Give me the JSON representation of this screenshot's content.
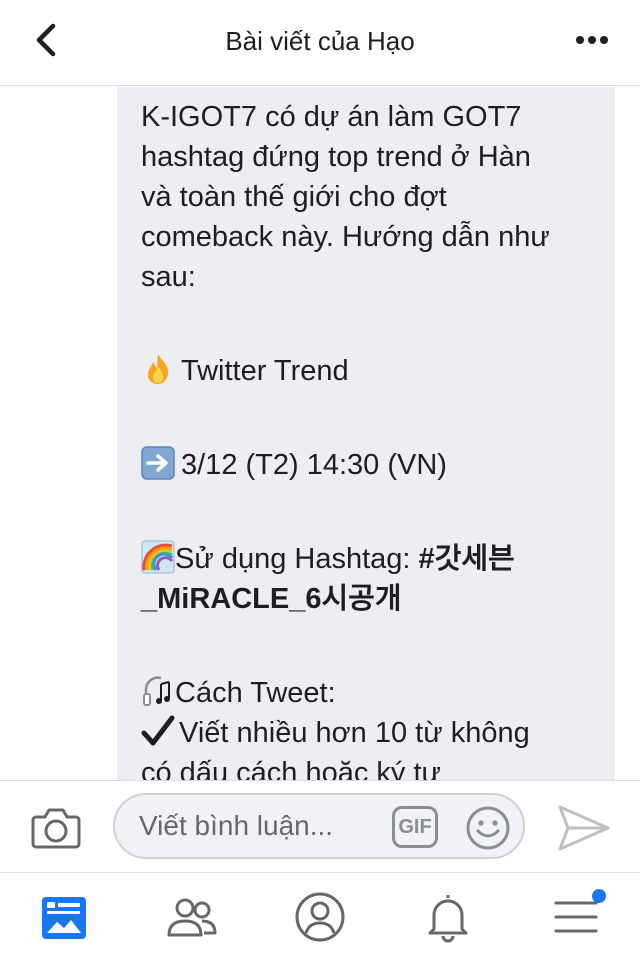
{
  "header": {
    "title": "Bài viết của Hạo",
    "back_icon": "chevron-left-icon",
    "more_icon": "more-horizontal-icon"
  },
  "post": {
    "lines": [
      "K-IGOT7 có dự án làm GOT7",
      "hashtag đứng top trend ở Hàn",
      "và toàn thế giới cho đợt",
      "comeback này. Hướng dẫn như",
      "sau:"
    ],
    "trend_label": "Twitter Trend",
    "date_label": "3/12 (T2) 14:30 (VN)",
    "hashtag_prefix": "Sử dụng Hashtag: ",
    "hashtag_part1": "#갓세븐",
    "hashtag_part2": "_MiRACLE_6시공개",
    "tweet_label": "Cách Tweet:",
    "tip_1": "Viết nhiều hơn 10 từ không",
    "tip_2": "có dấu cách hoặc ký tự"
  },
  "comment_bar": {
    "placeholder": "Viết bình luận...",
    "gif_label": "GIF",
    "camera_icon": "camera-icon",
    "smiley_icon": "smiley-icon",
    "send_icon": "send-icon"
  },
  "nav": {
    "items": [
      "news-feed-icon",
      "friends-icon",
      "profile-icon",
      "bell-icon",
      "menu-icon"
    ],
    "active": "news-feed",
    "accent": "#1877f2"
  }
}
